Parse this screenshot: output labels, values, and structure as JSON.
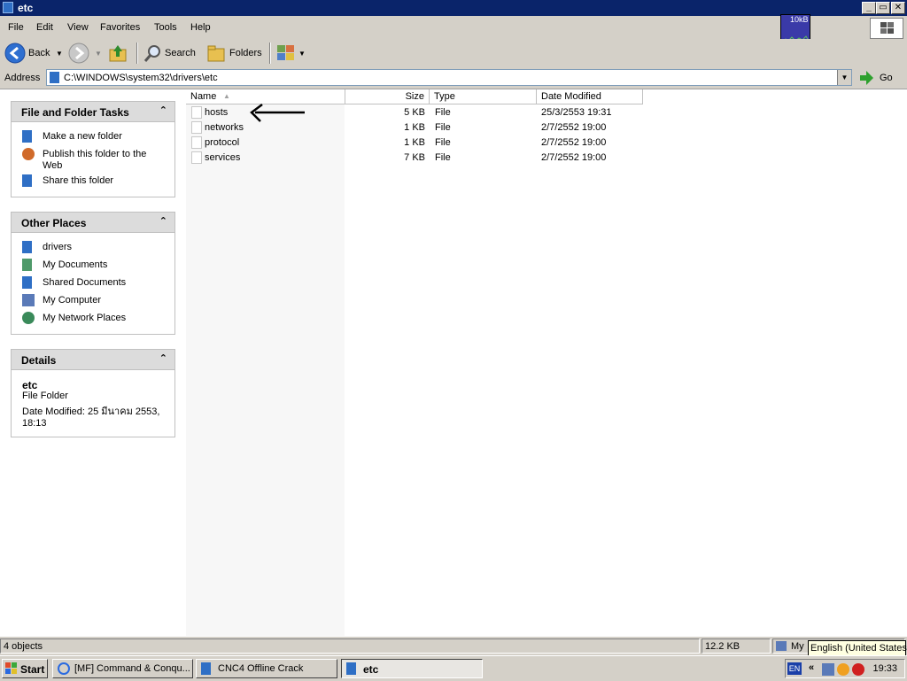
{
  "window": {
    "title": "etc"
  },
  "menu": {
    "items": [
      "File",
      "Edit",
      "View",
      "Favorites",
      "Tools",
      "Help"
    ]
  },
  "netmon": {
    "label": "10kB"
  },
  "toolbar": {
    "back_label": "Back",
    "search_label": "Search",
    "folders_label": "Folders"
  },
  "address": {
    "label": "Address",
    "value": "C:\\WINDOWS\\system32\\drivers\\etc",
    "go_label": "Go"
  },
  "tasks_panel": {
    "title": "File and Folder Tasks",
    "items": [
      "Make a new folder",
      "Publish this folder to the Web",
      "Share this folder"
    ]
  },
  "places_panel": {
    "title": "Other Places",
    "items": [
      "drivers",
      "My Documents",
      "Shared Documents",
      "My Computer",
      "My Network Places"
    ]
  },
  "details_panel": {
    "title": "Details",
    "name": "etc",
    "type": "File Folder",
    "modified": "Date Modified: 25 มีนาคม 2553, 18:13"
  },
  "columns": {
    "name": "Name",
    "size": "Size",
    "type": "Type",
    "modified": "Date Modified"
  },
  "files": [
    {
      "name": "hosts",
      "size": "5 KB",
      "type": "File",
      "modified": "25/3/2553 19:31"
    },
    {
      "name": "networks",
      "size": "1 KB",
      "type": "File",
      "modified": "2/7/2552 19:00"
    },
    {
      "name": "protocol",
      "size": "1 KB",
      "type": "File",
      "modified": "2/7/2552 19:00"
    },
    {
      "name": "services",
      "size": "7 KB",
      "type": "File",
      "modified": "2/7/2552 19:00"
    }
  ],
  "status": {
    "objects": "4 objects",
    "size": "12.2 KB",
    "location": "My"
  },
  "tooltip": {
    "text": "English (United States)"
  },
  "taskbar": {
    "start_label": "Start",
    "tasks": [
      "[MF] Command & Conqu...",
      "CNC4 Offline Crack",
      "etc"
    ],
    "lang": "EN",
    "clock": "19:33"
  }
}
